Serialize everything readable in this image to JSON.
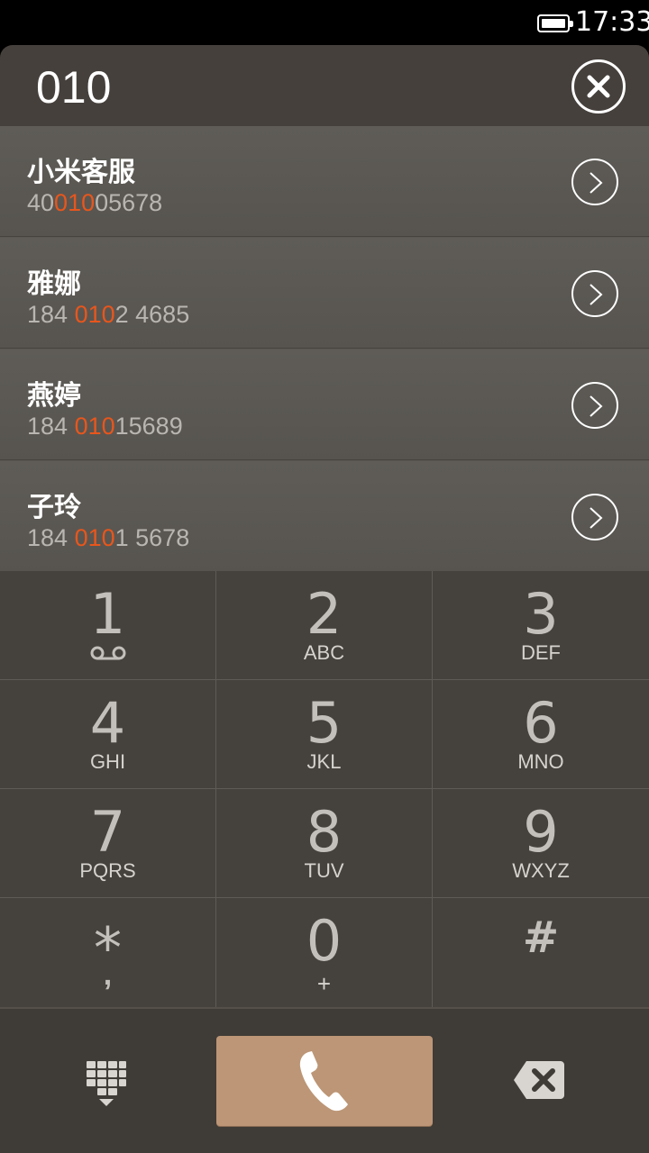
{
  "status": {
    "time": "17:33"
  },
  "dialer": {
    "number": "010"
  },
  "contacts": [
    {
      "name": "小米客服",
      "phone_pre": "40",
      "phone_match": "010",
      "phone_post": "05678"
    },
    {
      "name": "雅娜",
      "phone_pre": "184 ",
      "phone_match": "010",
      "phone_post": "2 4685"
    },
    {
      "name": "燕婷",
      "phone_pre": "184 ",
      "phone_match": "010",
      "phone_post": "15689"
    },
    {
      "name": "子玲",
      "phone_pre": "184 ",
      "phone_match": "010",
      "phone_post": "1 5678"
    }
  ],
  "keys": [
    {
      "digit": "1",
      "letters": ""
    },
    {
      "digit": "2",
      "letters": "ABC"
    },
    {
      "digit": "3",
      "letters": "DEF"
    },
    {
      "digit": "4",
      "letters": "GHI"
    },
    {
      "digit": "5",
      "letters": "JKL"
    },
    {
      "digit": "6",
      "letters": "MNO"
    },
    {
      "digit": "7",
      "letters": "PQRS"
    },
    {
      "digit": "8",
      "letters": "TUV"
    },
    {
      "digit": "9",
      "letters": "WXYZ"
    },
    {
      "digit": "*",
      "letters": ","
    },
    {
      "digit": "0",
      "letters": "+"
    },
    {
      "digit": "#",
      "letters": ""
    }
  ],
  "colors": {
    "match_highlight": "#e8561c",
    "call_button": "#bc9676",
    "keypad_bg": "#45413d"
  },
  "icons": {
    "voicemail": "voicemail-icon",
    "clear": "close-icon",
    "contact_detail": "chevron-right-icon",
    "dialpad_toggle": "dialpad-icon",
    "call": "phone-icon",
    "backspace": "backspace-icon"
  }
}
